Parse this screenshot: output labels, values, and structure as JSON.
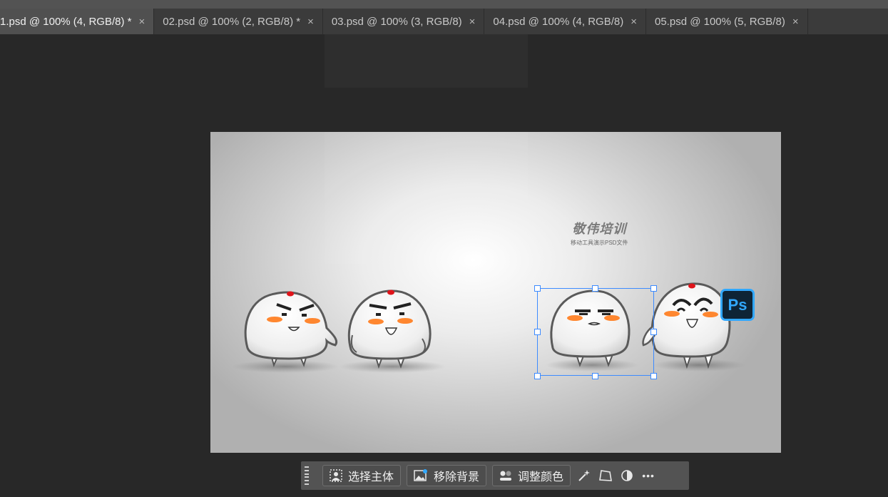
{
  "tabs": [
    {
      "label": "1.psd @ 100% (4, RGB/8) *",
      "close": "×",
      "active": true
    },
    {
      "label": "02.psd @ 100% (2, RGB/8) *",
      "close": "×",
      "active": false
    },
    {
      "label": "03.psd @ 100% (3, RGB/8)",
      "close": "×",
      "active": false
    },
    {
      "label": "04.psd @ 100% (4, RGB/8)",
      "close": "×",
      "active": false
    },
    {
      "label": "05.psd @ 100% (5, RGB/8)",
      "close": "×",
      "active": false
    }
  ],
  "canvas": {
    "brand_title": "敬伟培训",
    "brand_subtitle": "移动工具演示PSD文件",
    "ps_badge": "Ps"
  },
  "context_bar": {
    "select_subject": "选择主体",
    "remove_background": "移除背景",
    "adjust_color": "调整颜色",
    "more": "•••"
  },
  "colors": {
    "selection": "#3d8bff",
    "ps_blue": "#31a8ff",
    "blush": "#ff7a1a",
    "dot": "#e0141a"
  }
}
